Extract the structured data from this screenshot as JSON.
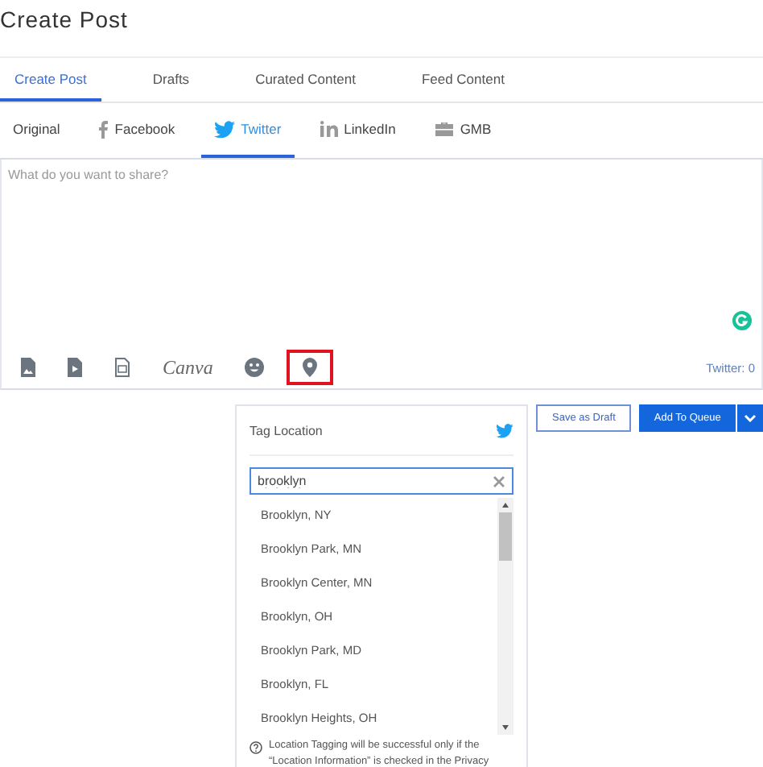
{
  "page_title": "Create Post",
  "tabs": [
    {
      "label": "Create Post",
      "selected": true
    },
    {
      "label": "Drafts",
      "selected": false
    },
    {
      "label": "Curated Content",
      "selected": false
    },
    {
      "label": "Feed Content",
      "selected": false
    }
  ],
  "networks": [
    {
      "label": "Original",
      "kind": "none",
      "selected": false
    },
    {
      "label": "Facebook",
      "kind": "facebook",
      "selected": false
    },
    {
      "label": "Twitter",
      "kind": "twitter",
      "selected": true
    },
    {
      "label": "LinkedIn",
      "kind": "linkedin",
      "selected": false
    },
    {
      "label": "GMB",
      "kind": "gmb",
      "selected": false
    }
  ],
  "editor": {
    "placeholder": "What do you want to share?",
    "counter": "Twitter: 0"
  },
  "tools": [
    {
      "kind": "image",
      "highlighted": false
    },
    {
      "kind": "video",
      "highlighted": false
    },
    {
      "kind": "document",
      "highlighted": false
    },
    {
      "kind": "canva",
      "label": "Canva",
      "highlighted": false
    },
    {
      "kind": "emoji",
      "highlighted": false
    },
    {
      "kind": "location",
      "highlighted": true
    }
  ],
  "tag_location": {
    "title": "Tag Location",
    "search": {
      "value": "brooklyn"
    },
    "results": [
      "Brooklyn, NY",
      "Brooklyn Park, MN",
      "Brooklyn Center, MN",
      "Brooklyn, OH",
      "Brooklyn Park, MD",
      "Brooklyn, FL",
      "Brooklyn Heights, OH"
    ],
    "note": "Location Tagging will be successful only if the “Location Information” is checked in the Privacy"
  },
  "buttons": {
    "draft": "Save as Draft",
    "queue": "Add To Queue"
  }
}
